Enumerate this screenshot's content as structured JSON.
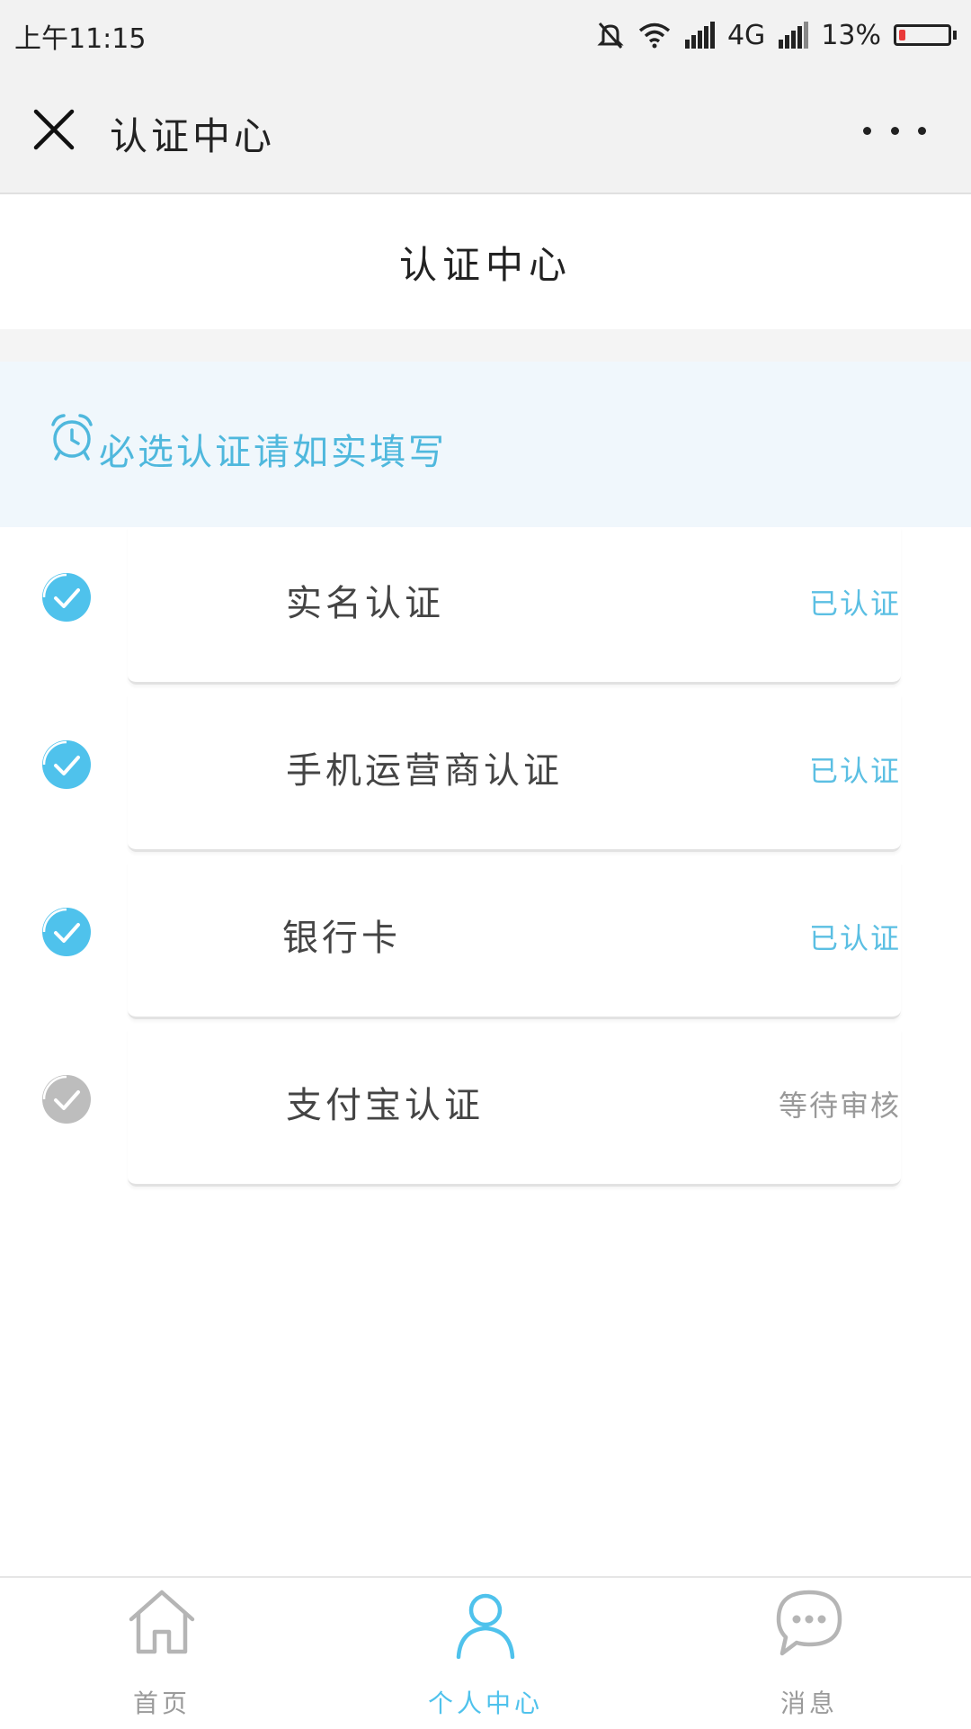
{
  "status_bar": {
    "time": "上午11:15",
    "network": "4G",
    "battery": "13%",
    "battery_level": 0.13,
    "icons": [
      "bell-off-icon",
      "wifi-icon",
      "signal-icon",
      "signal-icon",
      "battery-icon"
    ]
  },
  "title_bar": {
    "title": "认证中心",
    "close_icon": "close-icon",
    "more_icon": "more-dots-icon"
  },
  "header": {
    "title": "认证中心"
  },
  "notice": {
    "icon": "alarm-clock-icon",
    "text": "必选认证请如实填写",
    "color": "#4fb8dd"
  },
  "auth_items": [
    {
      "label": "实名认证",
      "status": "已认证",
      "verified": true
    },
    {
      "label": "手机运营商认证",
      "status": "已认证",
      "verified": true
    },
    {
      "label": "银行卡",
      "status": "已认证",
      "verified": true
    },
    {
      "label": "支付宝认证",
      "status": "等待审核",
      "verified": false
    }
  ],
  "colors": {
    "accent": "#4fc2ec",
    "verified_text": "#5bbfe3",
    "pending_text": "#999999",
    "pending_icon": "#bdbdbd"
  },
  "bottom_nav": [
    {
      "label": "首页",
      "icon": "home-icon",
      "active": false
    },
    {
      "label": "个人中心",
      "icon": "user-icon",
      "active": true
    },
    {
      "label": "消息",
      "icon": "message-icon",
      "active": false
    }
  ]
}
